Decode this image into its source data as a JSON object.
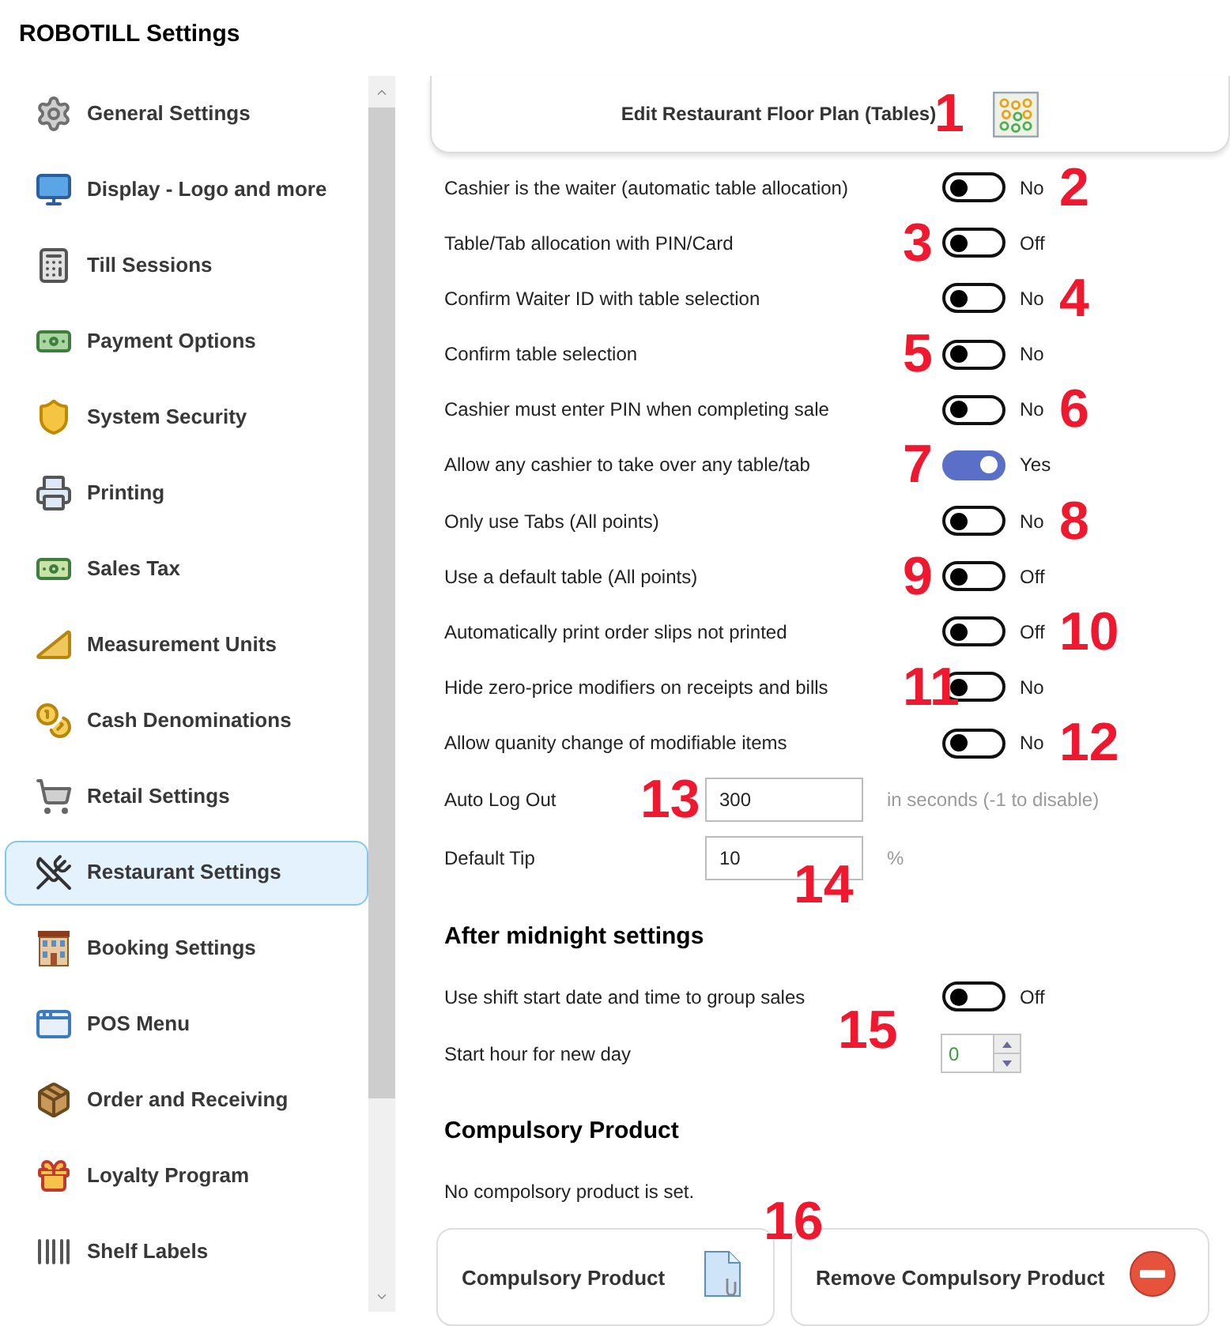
{
  "window": {
    "title": "ROBOTILL Settings"
  },
  "sidebar": {
    "items": [
      {
        "label": "General Settings",
        "selected": false
      },
      {
        "label": "Display - Logo and more",
        "selected": false
      },
      {
        "label": "Till Sessions",
        "selected": false
      },
      {
        "label": "Payment Options",
        "selected": false
      },
      {
        "label": "System Security",
        "selected": false
      },
      {
        "label": "Printing",
        "selected": false
      },
      {
        "label": "Sales Tax",
        "selected": false
      },
      {
        "label": "Measurement Units",
        "selected": false
      },
      {
        "label": "Cash Denominations",
        "selected": false
      },
      {
        "label": "Retail Settings",
        "selected": false
      },
      {
        "label": "Restaurant Settings",
        "selected": true
      },
      {
        "label": "Booking Settings",
        "selected": false
      },
      {
        "label": "POS Menu",
        "selected": false
      },
      {
        "label": "Order and Receiving",
        "selected": false
      },
      {
        "label": "Loyalty Program",
        "selected": false
      },
      {
        "label": "Shelf Labels",
        "selected": false
      }
    ]
  },
  "floor_plan_button": {
    "label": "Edit Restaurant Floor Plan (Tables)",
    "callout": "1"
  },
  "settings": [
    {
      "kind": "toggle",
      "label": "Cashier is the waiter (automatic table allocation)",
      "on": false,
      "state_text": "No",
      "callout": "2"
    },
    {
      "kind": "toggle",
      "label": "Table/Tab allocation with PIN/Card",
      "on": false,
      "state_text": "Off",
      "callout": "3"
    },
    {
      "kind": "toggle",
      "label": "Confirm Waiter ID with table selection",
      "on": false,
      "state_text": "No",
      "callout": "4"
    },
    {
      "kind": "toggle",
      "label": "Confirm table selection",
      "on": false,
      "state_text": "No",
      "callout": "5"
    },
    {
      "kind": "toggle",
      "label": "Cashier must enter PIN when completing sale",
      "on": false,
      "state_text": "No",
      "callout": "6"
    },
    {
      "kind": "toggle",
      "label": "Allow any cashier to take over any table/tab",
      "on": true,
      "state_text": "Yes",
      "callout": "7"
    },
    {
      "kind": "toggle",
      "label": "Only use Tabs (All points)",
      "on": false,
      "state_text": "No",
      "callout": "8"
    },
    {
      "kind": "toggle",
      "label": "Use a default table (All points)",
      "on": false,
      "state_text": "Off",
      "callout": "9"
    },
    {
      "kind": "toggle",
      "label": "Automatically print order slips not printed",
      "on": false,
      "state_text": "Off",
      "callout": "10"
    },
    {
      "kind": "toggle",
      "label": "Hide zero-price modifiers on receipts and bills",
      "on": false,
      "state_text": "No",
      "callout": "11"
    },
    {
      "kind": "toggle",
      "label": "Allow quanity change of modifiable items",
      "on": false,
      "state_text": "No",
      "callout": "12"
    },
    {
      "kind": "input",
      "label": "Auto Log Out",
      "value": "300",
      "hint": "in seconds (-1 to disable)",
      "callout": "13"
    },
    {
      "kind": "input",
      "label": "Default Tip",
      "value": "10",
      "hint": "%",
      "callout": "14"
    }
  ],
  "after_midnight": {
    "heading": "After midnight settings",
    "callout": "15",
    "settings": [
      {
        "kind": "toggle",
        "label": "Use shift start date and time to group sales",
        "on": false,
        "state_text": "Off"
      },
      {
        "kind": "spinner",
        "label": "Start hour for new day",
        "value": "0"
      }
    ]
  },
  "compulsory_product": {
    "heading": "Compulsory Product",
    "message": "No compolsory product is set.",
    "callout": "16",
    "buttons": [
      {
        "kind": "set",
        "label": "Compulsory Product"
      },
      {
        "kind": "remove",
        "label": "Remove Compulsory Product"
      }
    ]
  }
}
